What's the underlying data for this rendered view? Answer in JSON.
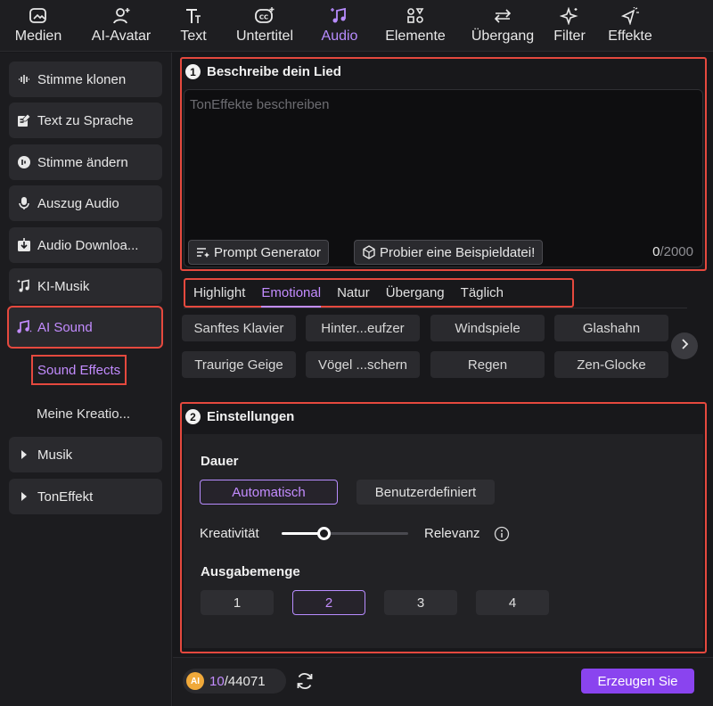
{
  "toolbar": {
    "tools": [
      {
        "label": "Medien",
        "icon": "media-icon"
      },
      {
        "label": "AI-Avatar",
        "icon": "avatar-icon"
      },
      {
        "label": "Text",
        "icon": "text-icon"
      },
      {
        "label": "Untertitel",
        "icon": "subtitle-icon"
      },
      {
        "label": "Audio",
        "icon": "audio-icon",
        "active": true
      },
      {
        "label": "Elemente",
        "icon": "elements-icon"
      },
      {
        "label": "Übergang",
        "icon": "transition-icon"
      },
      {
        "label": "Filter",
        "icon": "filter-icon"
      },
      {
        "label": "Effekte",
        "icon": "effects-icon"
      }
    ]
  },
  "sidebar": {
    "items": [
      {
        "label": "Stimme klonen",
        "icon": "waveform-icon"
      },
      {
        "label": "Text zu Sprache",
        "icon": "text-to-speech-icon"
      },
      {
        "label": "Stimme ändern",
        "icon": "voice-change-icon"
      },
      {
        "label": "Auszug Audio",
        "icon": "microphone-icon"
      },
      {
        "label": "Audio Downloa...",
        "icon": "download-icon"
      },
      {
        "label": "KI-Musik",
        "icon": "music-note-icon"
      },
      {
        "label": "AI Sound",
        "icon": "ai-sound-icon"
      }
    ],
    "sub_items": [
      {
        "label": "Sound Effects",
        "active": true
      },
      {
        "label": "Meine Kreatio..."
      }
    ],
    "groups": [
      {
        "label": "Musik"
      },
      {
        "label": "TonEffekt"
      }
    ]
  },
  "describe": {
    "number": "1",
    "title": "Beschreibe dein Lied",
    "placeholder": "TonEffekte beschreiben",
    "prompt_generator": "Prompt Generator",
    "example_file": "Probier eine Beispieldatei!",
    "count_current": "0",
    "count_max": "/2000"
  },
  "categories": {
    "tabs": [
      "Highlight",
      "Emotional",
      "Natur",
      "Übergang",
      "Täglich"
    ],
    "active_tab": "Emotional",
    "chips": [
      "Sanftes Klavier",
      "Hinter...eufzer",
      "Windspiele",
      "Glashahn",
      "Traurige Geige",
      "Vögel ...schern",
      "Regen",
      "Zen-Glocke"
    ]
  },
  "settings": {
    "number": "2",
    "title": "Einstellungen",
    "duration_label": "Dauer",
    "duration_options": [
      "Automatisch",
      "Benutzerdefiniert"
    ],
    "duration_selected": "Automatisch",
    "slider_left_label": "Kreativität",
    "slider_right_label": "Relevanz",
    "slider_value": 0.33,
    "output_label": "Ausgabemenge",
    "output_options": [
      "1",
      "2",
      "3",
      "4"
    ],
    "output_selected": "2"
  },
  "footer": {
    "coin_label": "AI",
    "credits_used": "10",
    "credits_total": "/44071",
    "generate_label": "Erzeugen Sie"
  },
  "colors": {
    "accent": "#c38cff",
    "highlight_border": "#e5493e",
    "generate_button": "#8a44ef"
  }
}
